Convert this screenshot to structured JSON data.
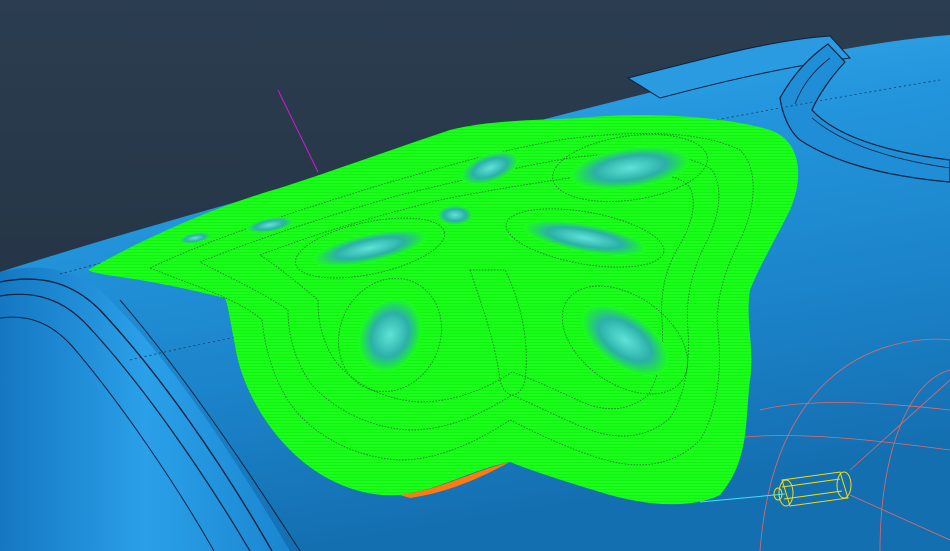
{
  "viewport": {
    "background_top": "#2b3d50",
    "background_bottom": "#1f2e3d"
  },
  "colors": {
    "cylinder_body": "#1f8fd8",
    "cylinder_light": "#3aa8ee",
    "cylinder_dark": "#0f5c9a",
    "edge_line": "#0a2240",
    "toolpath_green": "#19ff19",
    "toolpath_dark_contour": "#0a6b1a",
    "pocket_cyan": "#4fd0c8",
    "axis_magenta": "#d01ad0",
    "tool_yellow": "#f0e010",
    "sketch_red": "#e06a6a",
    "leading_edge_orange": "#ff7a10",
    "feed_line_cyan": "#40e0ff"
  },
  "objects": {
    "part": "cylindrical-workpiece",
    "toolpath": "butterfly-relief-toolpath",
    "tool": "cylindrical-cutter",
    "axis": "tool-axis-vector"
  }
}
